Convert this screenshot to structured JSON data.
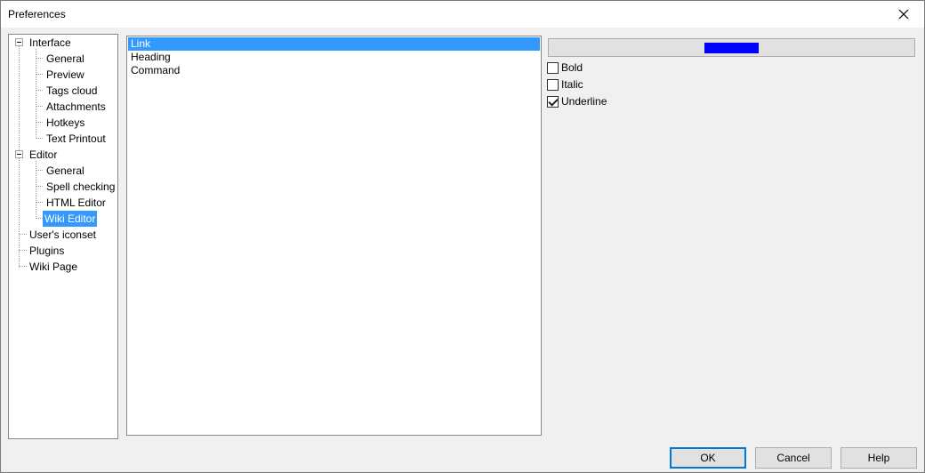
{
  "window": {
    "title": "Preferences"
  },
  "tree": {
    "nodes": [
      {
        "label": "Interface"
      },
      {
        "label": "General"
      },
      {
        "label": "Preview"
      },
      {
        "label": "Tags cloud"
      },
      {
        "label": "Attachments"
      },
      {
        "label": "Hotkeys"
      },
      {
        "label": "Text Printout"
      },
      {
        "label": "Editor"
      },
      {
        "label": "General"
      },
      {
        "label": "Spell checking"
      },
      {
        "label": "HTML Editor"
      },
      {
        "label": "Wiki Editor"
      },
      {
        "label": "User's iconset"
      },
      {
        "label": "Plugins"
      },
      {
        "label": "Wiki Page"
      }
    ],
    "selected": "Wiki Editor"
  },
  "list": {
    "items": [
      "Link",
      "Heading",
      "Command"
    ],
    "selected": "Link"
  },
  "style": {
    "color": "#0000ff",
    "bold_label": "Bold",
    "bold_checked": false,
    "italic_label": "Italic",
    "italic_checked": false,
    "underline_label": "Underline",
    "underline_checked": true
  },
  "buttons": {
    "ok": "OK",
    "cancel": "Cancel",
    "help": "Help"
  },
  "colors": {
    "selection": "#3399ff",
    "accent": "#0078d7"
  }
}
